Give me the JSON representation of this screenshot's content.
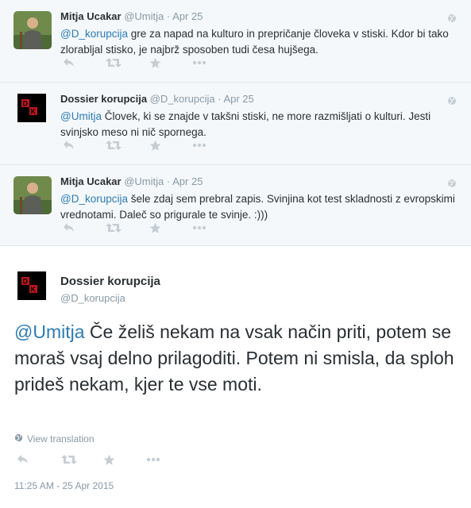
{
  "replies": [
    {
      "name": "Mitja Ucakar",
      "handle": "@Umitja",
      "separator": "·",
      "date": "Apr 25",
      "mention": "@D_korupcija",
      "text": " gre za napad na kulturo in prepričanje človeka v stiski. Kdor bi tako zlorabljal stisko, je najbrž sposoben tudi česa hujšega.",
      "avatar": "person-photo"
    },
    {
      "name": "Dossier korupcija",
      "handle": "@D_korupcija",
      "separator": "·",
      "date": "Apr 25",
      "mention": "@Umitja",
      "text": " Človek, ki se znajde v takšni stiski, ne more razmišljati o kulturi. Jesti svinjsko meso ni nič spornega.",
      "avatar": "dk-logo"
    },
    {
      "name": "Mitja Ucakar",
      "handle": "@Umitja",
      "separator": "·",
      "date": "Apr 25",
      "mention": "@D_korupcija",
      "text": " šele zdaj sem prebral zapis. Svinjina kot test skladnosti z evropskimi vrednotami. Daleč so prigurale te svinje. :)))",
      "avatar": "person-photo"
    }
  ],
  "main_tweet": {
    "name": "Dossier korupcija",
    "handle": "@D_korupcija",
    "mention": "@Umitja",
    "text": " Če želiš nekam na vsak način priti, potem se moraš vsaj delno prilagoditi. Potem ni smisla, da sploh prideš nekam, kjer te vse moti.",
    "view_translation": "View translation",
    "timestamp": "11:25 AM - 25 Apr 2015"
  },
  "icons": {
    "reply": "reply-icon",
    "retweet": "retweet-icon",
    "favorite": "star-icon",
    "more": "more-icon",
    "globe": "globe-icon"
  },
  "colors": {
    "link": "#2b7bb9",
    "muted": "#8899a6",
    "text": "#292f33",
    "reply_bg": "#f5f8fa",
    "logo_red": "#c0161c"
  }
}
